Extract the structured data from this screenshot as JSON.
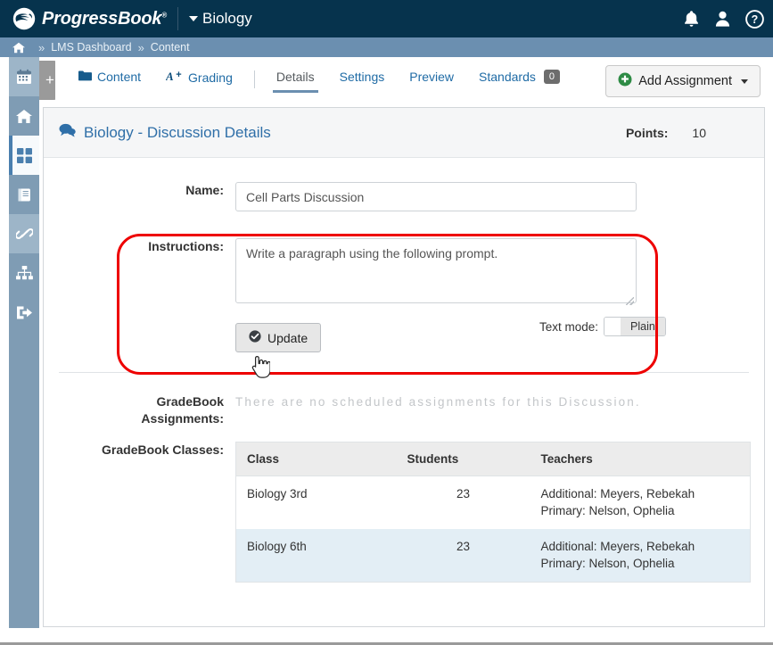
{
  "header": {
    "brand": "ProgressBook",
    "brand_mark": "®",
    "course": "Biology",
    "icons": [
      {
        "name": "notifications-bell-icon",
        "label": "Notifications"
      },
      {
        "name": "user-account-icon",
        "label": "Account"
      },
      {
        "name": "help-question-icon",
        "label": "Help"
      }
    ],
    "colors": {
      "bar": "#06334d",
      "breadcrumb_bar": "#6b8fb0"
    }
  },
  "breadcrumb": {
    "home_icon": "home-icon",
    "sep": "»",
    "items": [
      "LMS Dashboard",
      "Content"
    ]
  },
  "sidebar": {
    "plus_label": "+",
    "items": [
      {
        "name": "calendar-icon",
        "label": "Calendar",
        "state": "soft"
      },
      {
        "name": "home-icon",
        "label": "Home",
        "state": "normal"
      },
      {
        "name": "dashboard-grid-icon",
        "label": "Dashboard",
        "state": "active"
      },
      {
        "name": "gradebook-book-icon",
        "label": "GradeBook",
        "state": "normal"
      },
      {
        "name": "links-chain-icon",
        "label": "Links",
        "state": "soft"
      },
      {
        "name": "sitemap-icon",
        "label": "Site Map",
        "state": "normal"
      },
      {
        "name": "logout-icon",
        "label": "Sign Out",
        "state": "normal"
      }
    ]
  },
  "tabstrip": {
    "tabs": [
      {
        "label": "Content",
        "icon": "folder-icon",
        "current": false
      },
      {
        "label": "Grading",
        "icon": "a-plus-icon",
        "current": false
      },
      {
        "label": "Details",
        "icon": null,
        "current": true
      },
      {
        "label": "Settings",
        "icon": null,
        "current": false
      },
      {
        "label": "Preview",
        "icon": null,
        "current": false
      },
      {
        "label": "Standards",
        "icon": null,
        "current": false,
        "badge": "0"
      }
    ],
    "add_assignment": "Add Assignment"
  },
  "panel": {
    "title": "Biology - Discussion Details",
    "title_icon": "discussion-bubble-icon",
    "points_label": "Points:",
    "points_value": "10",
    "form": {
      "name_label": "Name:",
      "name_value": "Cell Parts Discussion",
      "name_placeholder": "Name",
      "instructions_label": "Instructions:",
      "instructions_value": "Write a paragraph using the following prompt.",
      "instructions_placeholder": "Instructions",
      "text_mode_label": "Text mode:",
      "text_mode_value": "Plain",
      "update_label": "Update",
      "update_icon": "check-circle-icon"
    },
    "gradebook_assignments": {
      "label_line1": "GradeBook",
      "label_line2": "Assignments:",
      "empty_text": "There are no scheduled assignments for this Discussion."
    },
    "gradebook_classes": {
      "label": "GradeBook Classes:",
      "columns": [
        "Class",
        "Students",
        "Teachers"
      ],
      "rows": [
        {
          "class": "Biology 3rd",
          "students": "23",
          "teachers_additional": "Additional: Meyers, Rebekah",
          "teachers_primary": "Primary: Nelson, Ophelia"
        },
        {
          "class": "Biology 6th",
          "students": "23",
          "teachers_additional": "Additional: Meyers, Rebekah",
          "teachers_primary": "Primary: Nelson, Ophelia"
        }
      ]
    }
  },
  "annotation": {
    "color": "#ee0000",
    "shape": "rounded-rectangle-highlight"
  },
  "cursor": {
    "type": "pointing-hand-cursor"
  }
}
